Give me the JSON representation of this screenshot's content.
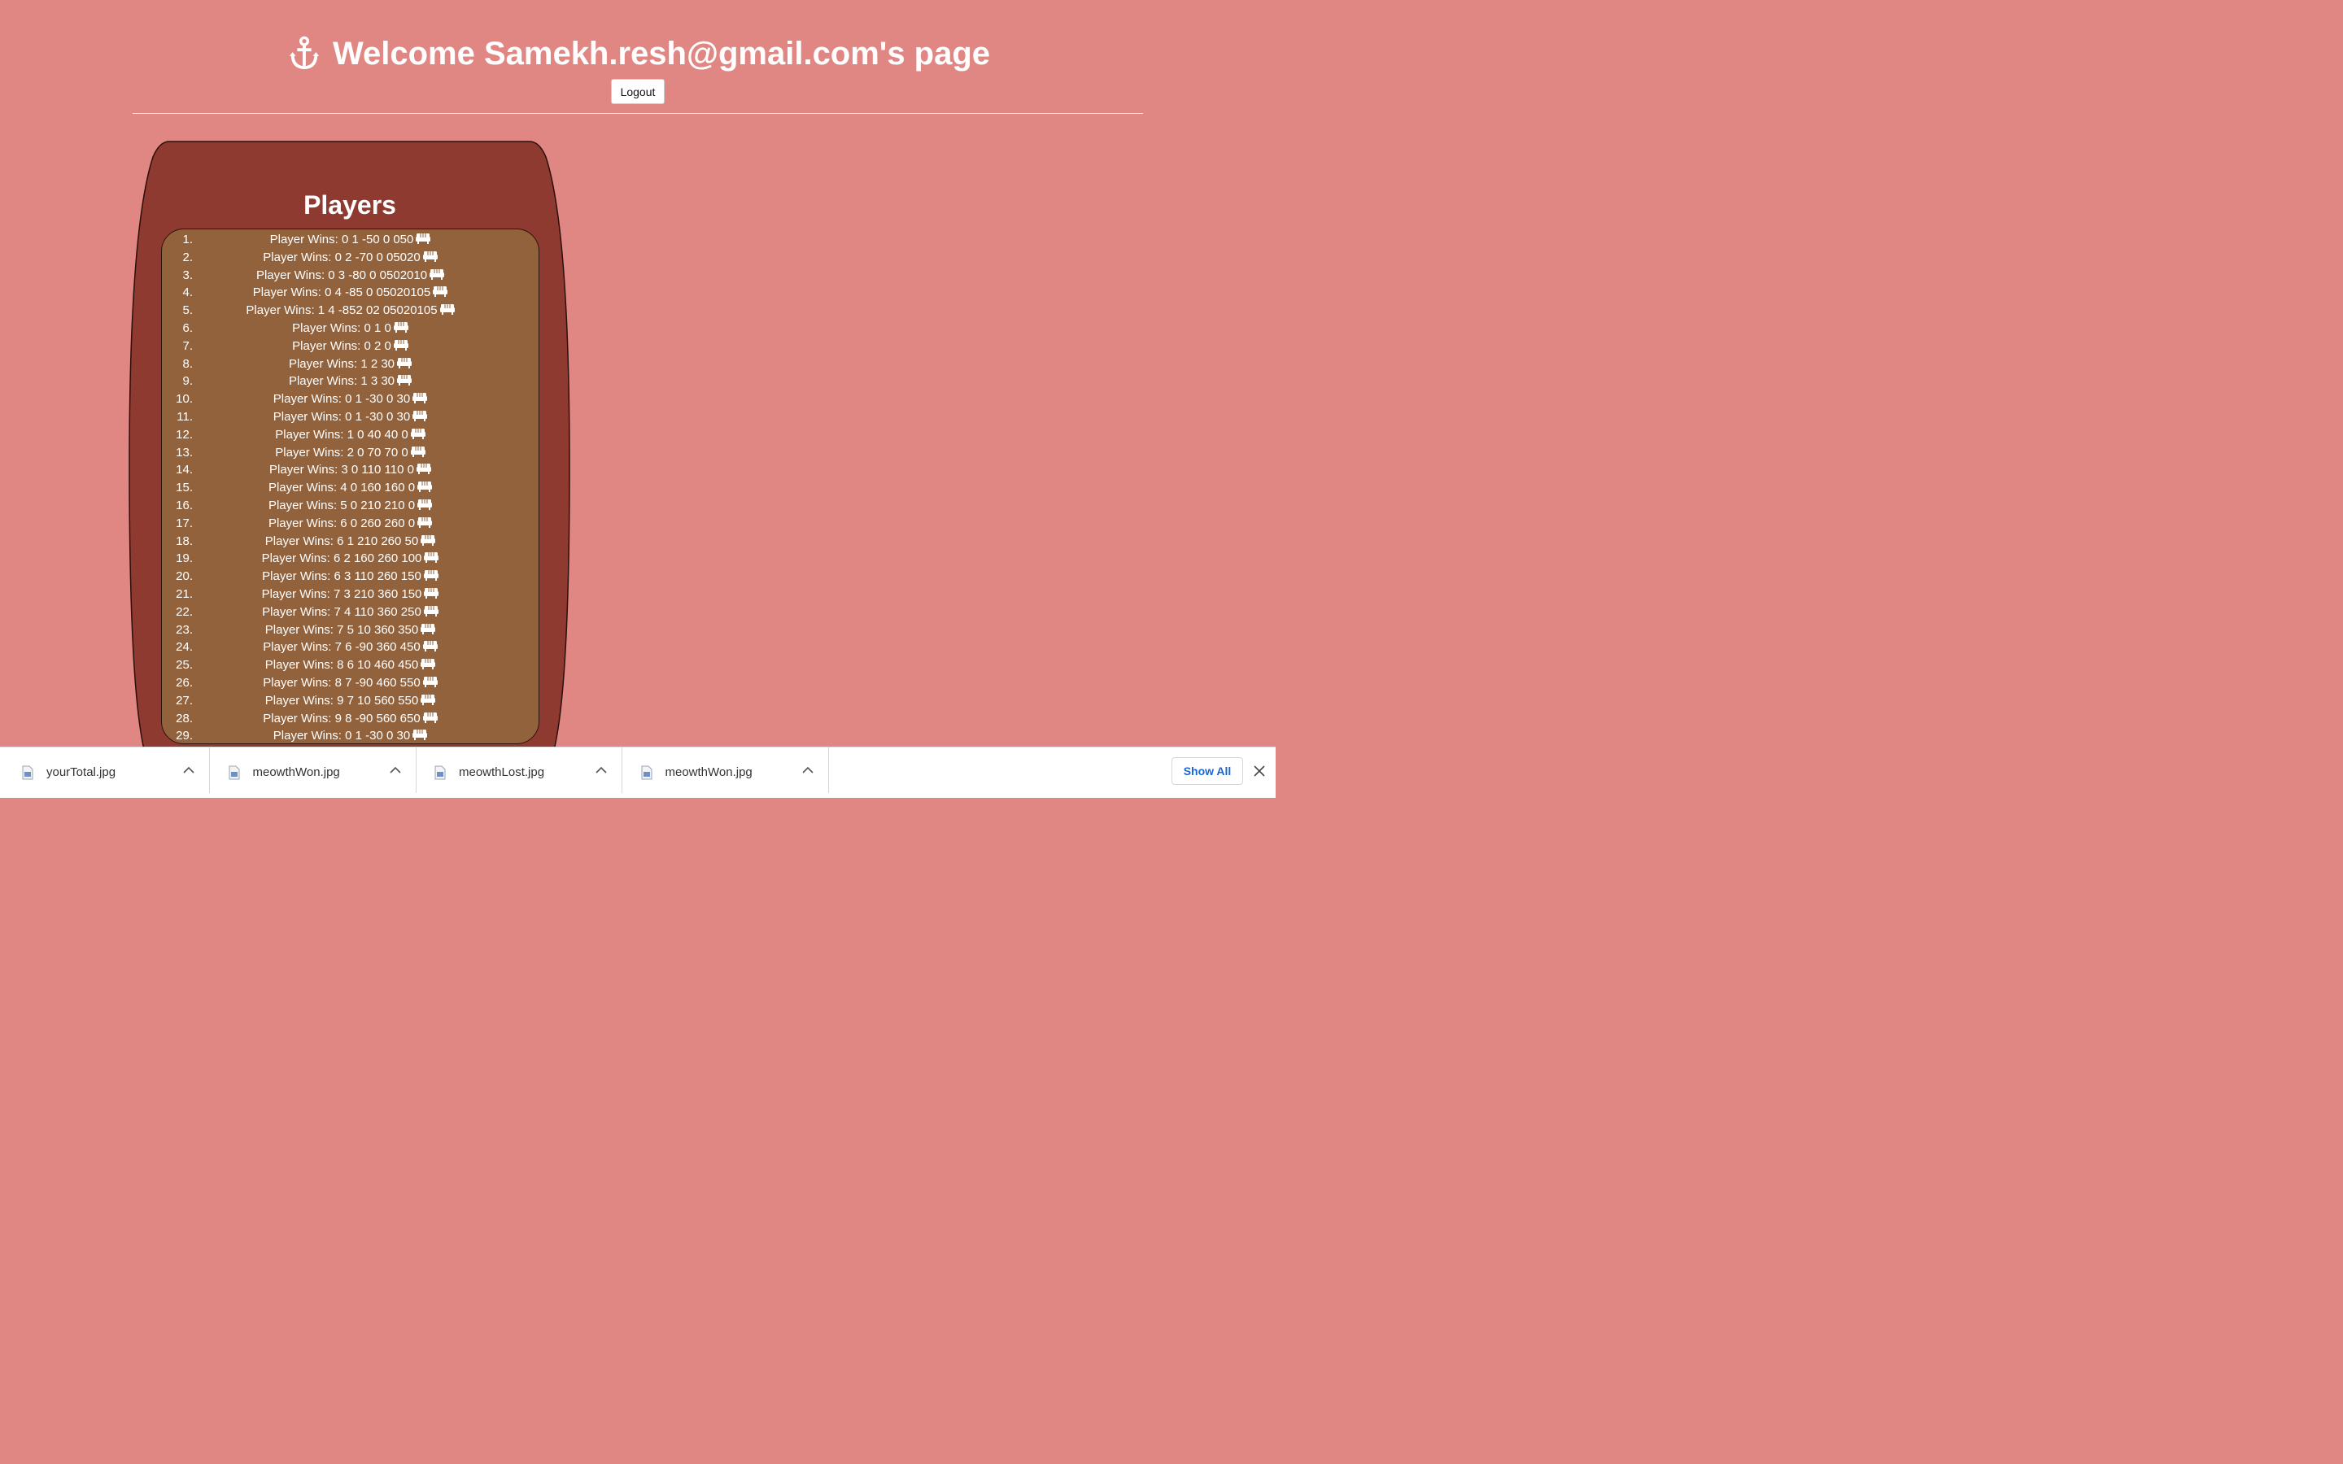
{
  "header": {
    "title": "Welcome Samekh.resh@gmail.com's page",
    "logout_label": "Logout"
  },
  "players": {
    "title": "Players",
    "rows": [
      {
        "num": "1.",
        "text": "Player Wins: 0 1 -50 0 050"
      },
      {
        "num": "2.",
        "text": "Player Wins: 0 2 -70 0 05020"
      },
      {
        "num": "3.",
        "text": "Player Wins: 0 3 -80 0 0502010"
      },
      {
        "num": "4.",
        "text": "Player Wins: 0 4 -85 0 05020105"
      },
      {
        "num": "5.",
        "text": "Player Wins: 1 4 -852 02 05020105"
      },
      {
        "num": "6.",
        "text": "Player Wins: 0 1 0"
      },
      {
        "num": "7.",
        "text": "Player Wins: 0 2 0"
      },
      {
        "num": "8.",
        "text": "Player Wins: 1 2 30"
      },
      {
        "num": "9.",
        "text": "Player Wins: 1 3 30"
      },
      {
        "num": "10.",
        "text": "Player Wins: 0 1 -30 0 30"
      },
      {
        "num": "11.",
        "text": "Player Wins: 0 1 -30 0 30"
      },
      {
        "num": "12.",
        "text": "Player Wins: 1 0 40 40 0"
      },
      {
        "num": "13.",
        "text": "Player Wins: 2 0 70 70 0"
      },
      {
        "num": "14.",
        "text": "Player Wins: 3 0 110 110 0"
      },
      {
        "num": "15.",
        "text": "Player Wins: 4 0 160 160 0"
      },
      {
        "num": "16.",
        "text": "Player Wins: 5 0 210 210 0"
      },
      {
        "num": "17.",
        "text": "Player Wins: 6 0 260 260 0"
      },
      {
        "num": "18.",
        "text": "Player Wins: 6 1 210 260 50"
      },
      {
        "num": "19.",
        "text": "Player Wins: 6 2 160 260 100"
      },
      {
        "num": "20.",
        "text": "Player Wins: 6 3 110 260 150"
      },
      {
        "num": "21.",
        "text": "Player Wins: 7 3 210 360 150"
      },
      {
        "num": "22.",
        "text": "Player Wins: 7 4 110 360 250"
      },
      {
        "num": "23.",
        "text": "Player Wins: 7 5 10 360 350"
      },
      {
        "num": "24.",
        "text": "Player Wins: 7 6 -90 360 450"
      },
      {
        "num": "25.",
        "text": "Player Wins: 8 6 10 460 450"
      },
      {
        "num": "26.",
        "text": "Player Wins: 8 7 -90 460 550"
      },
      {
        "num": "27.",
        "text": "Player Wins: 9 7 10 560 550"
      },
      {
        "num": "28.",
        "text": "Player Wins: 9 8 -90 560 650"
      },
      {
        "num": "29.",
        "text": "Player Wins: 0 1 -30 0 30"
      }
    ],
    "row_icon": "couch-icon"
  },
  "downloads": {
    "items": [
      {
        "name": "yourTotal.jpg"
      },
      {
        "name": "meowthWon.jpg"
      },
      {
        "name": "meowthLost.jpg"
      },
      {
        "name": "meowthWon.jpg"
      }
    ],
    "show_all_label": "Show All"
  },
  "colors": {
    "page_bg": "#e08783",
    "outer_panel": "#8f3a30",
    "list_box": "#92623d",
    "show_all_text": "#1a66d4"
  }
}
